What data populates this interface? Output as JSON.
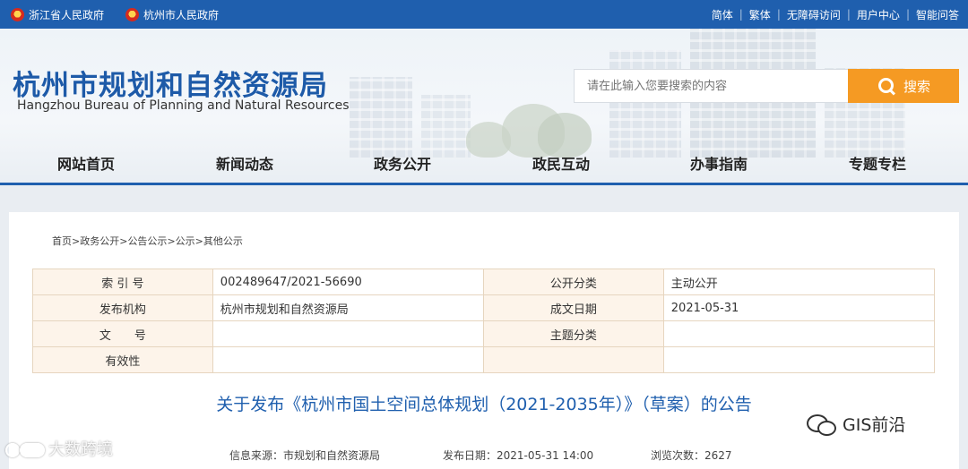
{
  "topbar": {
    "left_links": [
      "浙江省人民政府",
      "杭州市人民政府"
    ],
    "right_links": [
      "简体",
      "繁体",
      "无障碍访问",
      "用户中心",
      "智能问答"
    ]
  },
  "header": {
    "title_cn": "杭州市规划和自然资源局",
    "title_en": "Hangzhou Bureau of Planning and Natural Resources",
    "search_placeholder": "请在此输入您要搜索的内容",
    "search_button": "搜索"
  },
  "nav": [
    "网站首页",
    "新闻动态",
    "政务公开",
    "政民互动",
    "办事指南",
    "专题专栏"
  ],
  "breadcrumb": [
    "首页",
    "政务公开",
    "公告公示",
    "公示",
    "其他公示"
  ],
  "breadcrumb_sep": ">",
  "meta_table": [
    [
      "索 引 号",
      "002489647/2021-56690",
      "公开分类",
      "主动公开"
    ],
    [
      "发布机构",
      "杭州市规划和自然资源局",
      "成文日期",
      "2021-05-31"
    ],
    [
      "文　　号",
      "",
      "主题分类",
      ""
    ],
    [
      "有效性",
      "",
      "",
      ""
    ]
  ],
  "article": {
    "title": "关于发布《杭州市国土空间总体规划（2021-2035年）》（草案）的公告",
    "source": "信息来源：市规划和自然资源局",
    "date": "发布日期：2021-05-31 14:00",
    "views": "浏览次数：2627"
  },
  "watermarks": {
    "left": "大数跨境",
    "right": "GIS前沿"
  },
  "colors": {
    "primary_blue": "#1f5fae",
    "search_orange": "#f59a23",
    "table_key_bg": "#fdf4ea"
  }
}
